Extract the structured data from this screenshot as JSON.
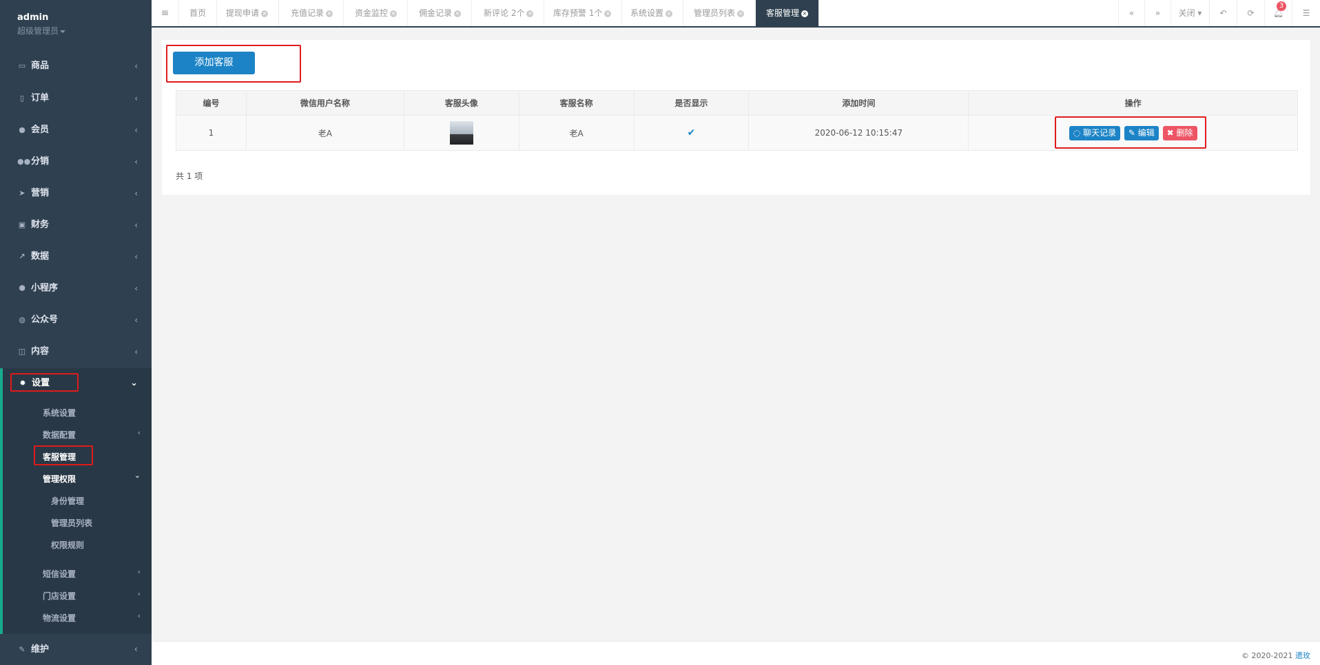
{
  "sidebar": {
    "username": "admin",
    "role": "超级管理员",
    "menu": [
      {
        "label": "商品",
        "icon": "laptop-icon"
      },
      {
        "label": "订单",
        "icon": "book-icon"
      },
      {
        "label": "会员",
        "icon": "user-icon"
      },
      {
        "label": "分销",
        "icon": "users-icon"
      },
      {
        "label": "营销",
        "icon": "paper-plane-icon"
      },
      {
        "label": "财务",
        "icon": "money-icon"
      },
      {
        "label": "数据",
        "icon": "line-chart-icon"
      },
      {
        "label": "小程序",
        "icon": "cubes-icon"
      },
      {
        "label": "公众号",
        "icon": "wechat-icon"
      },
      {
        "label": "内容",
        "icon": "open-book-icon"
      }
    ],
    "settings": {
      "label": "设置",
      "children": [
        "系统设置",
        "数据配置",
        "客服管理",
        "管理权限"
      ],
      "permission_children": [
        "身份管理",
        "管理员列表",
        "权限规则"
      ],
      "more": [
        "短信设置",
        "门店设置",
        "物流设置"
      ]
    },
    "maintenance": "维护"
  },
  "tabs": [
    {
      "label": "首页",
      "closable": false
    },
    {
      "label": "提现申请",
      "closable": true
    },
    {
      "label": "充值记录",
      "closable": true
    },
    {
      "label": "资金监控",
      "closable": true
    },
    {
      "label": "佣金记录",
      "closable": true
    },
    {
      "label": "新评论 2个",
      "closable": true
    },
    {
      "label": "库存预警 1个",
      "closable": true
    },
    {
      "label": "系统设置",
      "closable": true
    },
    {
      "label": "管理员列表",
      "closable": true
    },
    {
      "label": "客服管理",
      "closable": true,
      "active": true
    }
  ],
  "toolbar": {
    "close_label": "关闭",
    "notification_count": "3"
  },
  "content": {
    "add_button": "添加客服",
    "columns": [
      "编号",
      "微信用户名称",
      "客服头像",
      "客服名称",
      "是否显示",
      "添加时间",
      "操作"
    ],
    "rows": [
      {
        "id": "1",
        "wechat_name": "老A",
        "name": "老A",
        "visible": true,
        "added": "2020-06-12 10:15:47"
      }
    ],
    "actions": {
      "chat": "聊天记录",
      "edit": "编辑",
      "delete": "删除"
    },
    "total": "共 1 项"
  },
  "footer": {
    "copyright": "© 2020-2021",
    "link": "遗玫"
  },
  "colors": {
    "sidebar": "#2f4050",
    "primary": "#1c84c6",
    "danger": "#ed5565",
    "highlight_box": "#e01b1b"
  }
}
